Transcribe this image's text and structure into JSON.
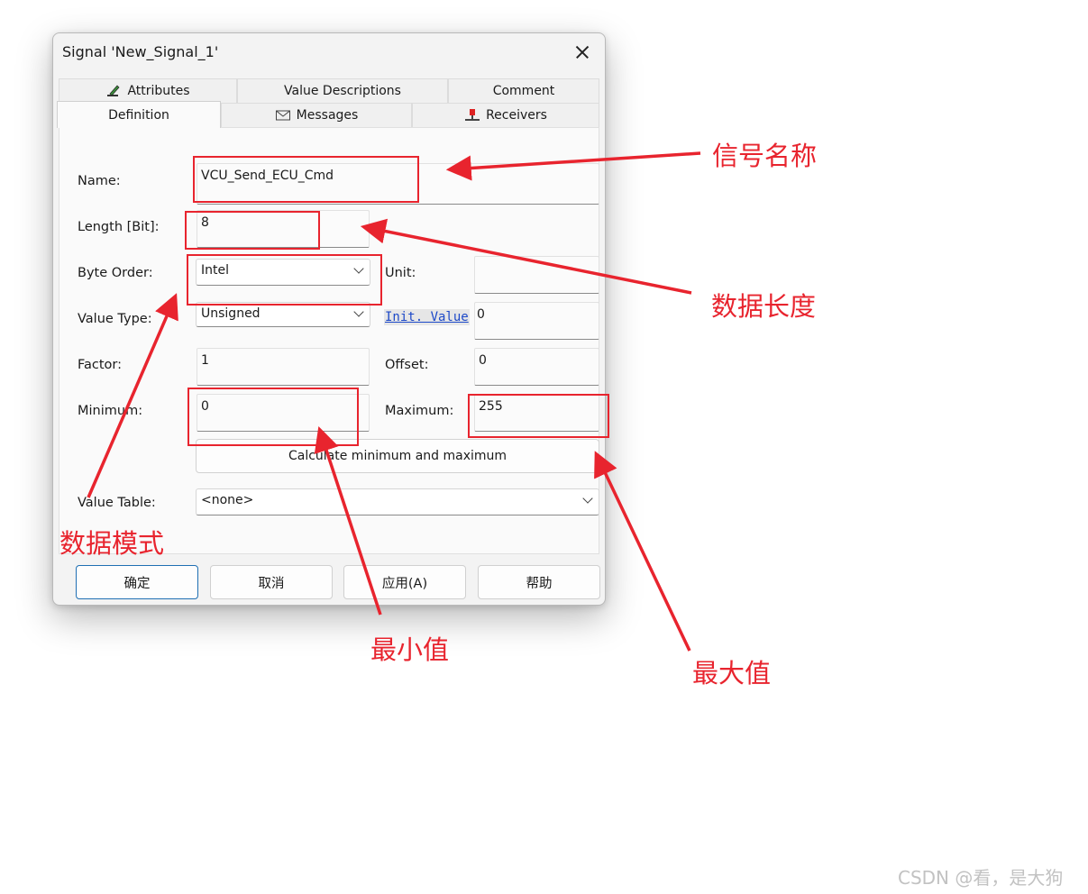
{
  "dialog": {
    "title": "Signal 'New_Signal_1'",
    "tabs_row1": [
      "Attributes",
      "Value Descriptions",
      "Comment"
    ],
    "tabs_row2": [
      "Definition",
      "Messages",
      "Receivers"
    ],
    "active_tab": "Definition"
  },
  "form": {
    "name_label": "Name:",
    "name_value": "VCU_Send_ECU_Cmd",
    "length_label": "Length [Bit]:",
    "length_value": "8",
    "byte_order_label": "Byte Order:",
    "byte_order_value": "Intel",
    "unit_label": "Unit:",
    "unit_value": "",
    "value_type_label": "Value Type:",
    "value_type_value": "Unsigned",
    "init_value_link": "Init. Value",
    "init_value": "0",
    "factor_label": "Factor:",
    "factor_value": "1",
    "offset_label": "Offset:",
    "offset_value": "0",
    "minimum_label": "Minimum:",
    "minimum_value": "0",
    "maximum_label": "Maximum:",
    "maximum_value": "255",
    "calc_button": "Calculate minimum and maximum",
    "value_table_label": "Value Table:",
    "value_table_value": "<none>"
  },
  "buttons": {
    "ok": "确定",
    "cancel": "取消",
    "apply": "应用(A)",
    "help": "帮助"
  },
  "annotations": {
    "signal_name": "信号名称",
    "data_length": "数据长度",
    "data_mode": "数据模式",
    "min_value": "最小值",
    "max_value": "最大值",
    "color": "#e8242e"
  },
  "watermark": "CSDN @看，是大狗"
}
